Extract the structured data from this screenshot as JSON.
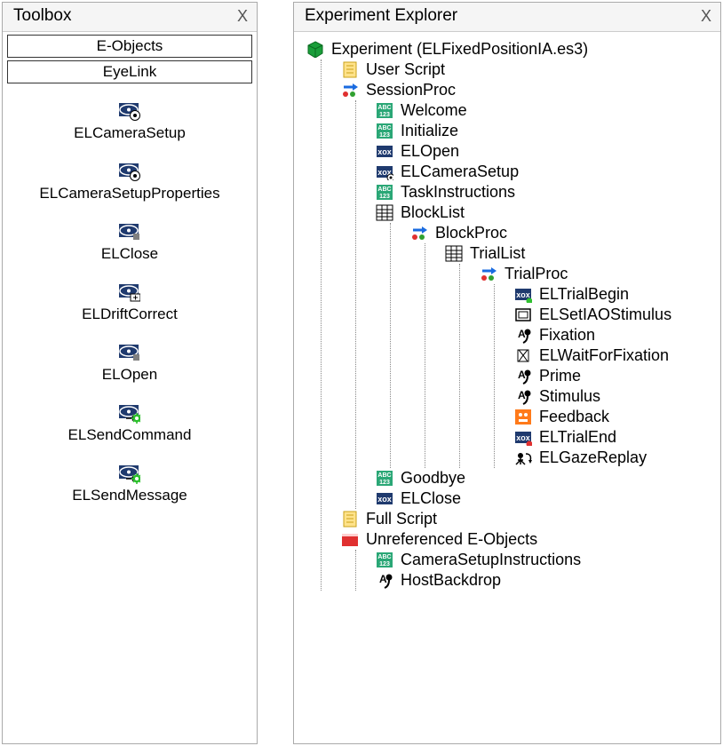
{
  "toolbox": {
    "title": "Toolbox",
    "close": "X",
    "tabs": {
      "eobjects": "E-Objects",
      "eyelink": "EyeLink"
    },
    "items": [
      {
        "label": "ELCameraSetup",
        "icon": "eye-dot"
      },
      {
        "label": "ELCameraSetupProperties",
        "icon": "eye-dot"
      },
      {
        "label": "ELClose",
        "icon": "eye-sq"
      },
      {
        "label": "ELDriftCorrect",
        "icon": "eye-drift"
      },
      {
        "label": "ELOpen",
        "icon": "eye-sq"
      },
      {
        "label": "ELSendCommand",
        "icon": "eye-gear"
      },
      {
        "label": "ELSendMessage",
        "icon": "eye-gear"
      }
    ]
  },
  "explorer": {
    "title": "Experiment Explorer",
    "close": "X",
    "tree": {
      "label": "Experiment (ELFixedPositionIA.es3)",
      "icon": "cube",
      "children": [
        {
          "label": "User Script",
          "icon": "script"
        },
        {
          "label": "SessionProc",
          "icon": "proc",
          "children": [
            {
              "label": "Welcome",
              "icon": "abc"
            },
            {
              "label": "Initialize",
              "icon": "abc"
            },
            {
              "label": "ELOpen",
              "icon": "xox"
            },
            {
              "label": "ELCameraSetup",
              "icon": "xox-dot"
            },
            {
              "label": "TaskInstructions",
              "icon": "abc"
            },
            {
              "label": "BlockList",
              "icon": "list",
              "children": [
                {
                  "label": "BlockProc",
                  "icon": "proc",
                  "children": [
                    {
                      "label": "TrialList",
                      "icon": "list",
                      "children": [
                        {
                          "label": "TrialProc",
                          "icon": "proc",
                          "children": [
                            {
                              "label": "ELTrialBegin",
                              "icon": "xox-green"
                            },
                            {
                              "label": "ELSetIAOStimulus",
                              "icon": "frame"
                            },
                            {
                              "label": "Fixation",
                              "icon": "an"
                            },
                            {
                              "label": "ELWaitForFixation",
                              "icon": "hourglass"
                            },
                            {
                              "label": "Prime",
                              "icon": "an"
                            },
                            {
                              "label": "Stimulus",
                              "icon": "an"
                            },
                            {
                              "label": "Feedback",
                              "icon": "feedback"
                            },
                            {
                              "label": "ELTrialEnd",
                              "icon": "xox-red"
                            },
                            {
                              "label": "ELGazeReplay",
                              "icon": "replay"
                            }
                          ]
                        }
                      ]
                    }
                  ]
                }
              ]
            },
            {
              "label": "Goodbye",
              "icon": "abc"
            },
            {
              "label": "ELClose",
              "icon": "xox"
            }
          ]
        },
        {
          "label": "Full Script",
          "icon": "script"
        },
        {
          "label": "Unreferenced E-Objects",
          "icon": "folder-red",
          "children": [
            {
              "label": "CameraSetupInstructions",
              "icon": "abc"
            },
            {
              "label": "HostBackdrop",
              "icon": "an"
            }
          ]
        }
      ]
    }
  }
}
